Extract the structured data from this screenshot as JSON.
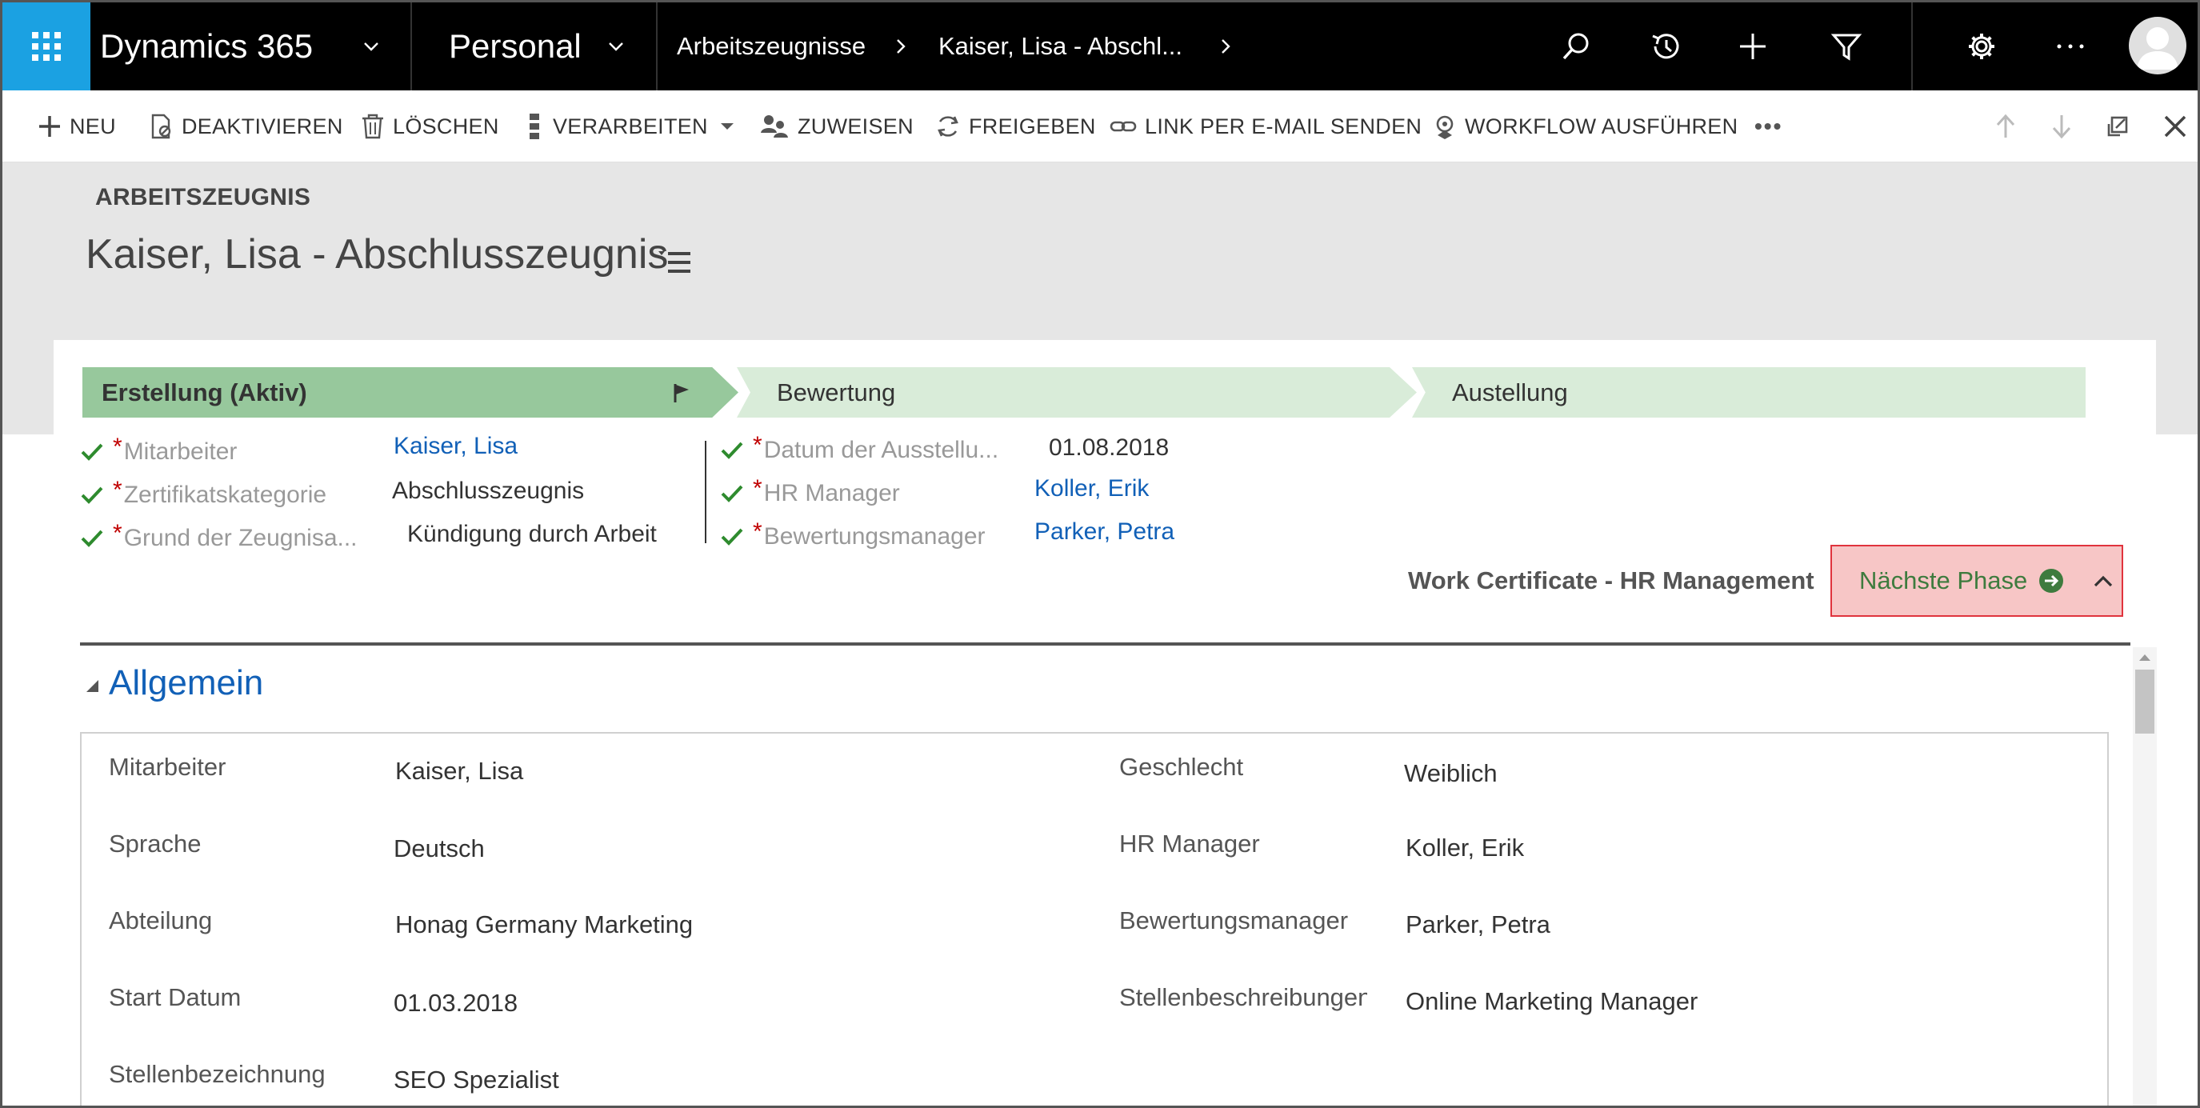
{
  "nav": {
    "app_name": "Dynamics 365",
    "area": "Personal",
    "breadcrumb_entity": "Arbeitszeugnisse",
    "breadcrumb_record": "Kaiser, Lisa  - Abschl...",
    "accent_color": "#1ba1e2",
    "icons": [
      "search-icon",
      "recent-icon",
      "plus-icon",
      "filter-icon",
      "gear-icon",
      "ellipsis-icon",
      "avatar"
    ]
  },
  "commands": {
    "neu": "NEU",
    "deaktivieren": "DEAKTIVIEREN",
    "loeschen": "LÖSCHEN",
    "verarbeiten": "VERARBEITEN",
    "zuweisen": "ZUWEISEN",
    "freigeben": "FREIGEBEN",
    "link": "LINK PER E-MAIL SENDEN",
    "workflow": "WORKFLOW AUSFÜHREN",
    "more": "•••"
  },
  "header": {
    "entity": "ARBEITSZEUGNIS",
    "title": "Kaiser, Lisa  - Abschlusszeugnis"
  },
  "process": {
    "stages": [
      "Erstellung (Aktiv)",
      "Bewertung",
      "Austellung"
    ],
    "active_color": "#97c89c",
    "inactive_color": "#d9ecd9",
    "left_fields": [
      {
        "label": "Mitarbeiter",
        "value": "Kaiser, Lisa"
      },
      {
        "label": "Zertifikatskategorie",
        "value": "Abschlusszeugnis"
      },
      {
        "label": "Grund der Zeugnisa...",
        "value": "Kündigung durch Arbeit"
      }
    ],
    "right_fields": [
      {
        "label": "Datum der Ausstellu...",
        "value": "01.08.2018"
      },
      {
        "label": "HR Manager",
        "value": "Koller, Erik"
      },
      {
        "label": "Bewertungsmanager",
        "value": "Parker, Petra"
      }
    ],
    "required_mark": "*",
    "process_name": "Work Certificate - HR Management",
    "next_phase": "Nächste Phase",
    "highlight_color": "#f7c6c6"
  },
  "section": {
    "title": "Allgemein",
    "left": [
      {
        "label": "Mitarbeiter",
        "value": "Kaiser, Lisa"
      },
      {
        "label": "Sprache",
        "value": "Deutsch"
      },
      {
        "label": "Abteilung",
        "value": "Honag Germany Marketing"
      },
      {
        "label": "Start Datum",
        "value": "01.03.2018"
      },
      {
        "label": "Stellenbezeichnung",
        "value": "SEO Spezialist"
      }
    ],
    "right": [
      {
        "label": "Geschlecht",
        "value": "Weiblich"
      },
      {
        "label": "HR Manager",
        "value": "Koller, Erik"
      },
      {
        "label": "Bewertungsmanager",
        "value": "Parker, Petra"
      },
      {
        "label": "Stellenbeschreibungen",
        "value": "Online Marketing Manager"
      }
    ]
  },
  "link_color": "#1160b7"
}
